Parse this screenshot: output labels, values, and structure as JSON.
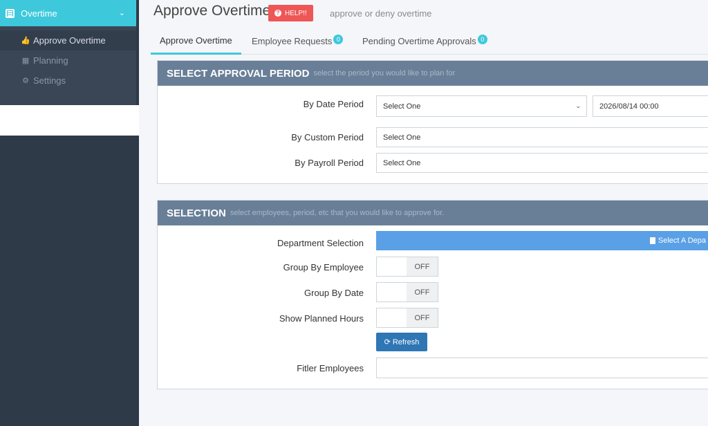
{
  "sidebar": {
    "menu_title": "Overtime",
    "items": [
      {
        "label": "Approve Overtime"
      },
      {
        "label": "Planning"
      },
      {
        "label": "Settings"
      }
    ]
  },
  "header": {
    "title": "Approve Overtime",
    "help_label": "HELP!!",
    "subtitle": "approve or deny overtime"
  },
  "tabs": [
    {
      "label": "Approve Overtime"
    },
    {
      "label": "Employee Requests",
      "badge": "0"
    },
    {
      "label": "Pending Overtime Approvals",
      "badge": "0"
    }
  ],
  "period_panel": {
    "title": "SELECT APPROVAL PERIOD",
    "subtitle": "select the period you would like to plan for",
    "date_period_label": "By Date Period",
    "date_period_value": "Select One",
    "date_value": "2026/08/14 00:00",
    "custom_period_label": "By Custom Period",
    "custom_period_value": "Select One",
    "payroll_period_label": "By Payroll Period",
    "payroll_period_value": "Select One"
  },
  "selection_panel": {
    "title": "SELECTION",
    "subtitle": "select employees, period, etc that you would like to approve for.",
    "department_label": "Department Selection",
    "department_button": "Select A Depa",
    "group_employee_label": "Group By Employee",
    "group_date_label": "Group By Date",
    "planned_hours_label": "Show Planned Hours",
    "toggle_off": "OFF",
    "refresh_label": "Refresh",
    "filter_label": "Fitler Employees",
    "filter_value": ""
  }
}
